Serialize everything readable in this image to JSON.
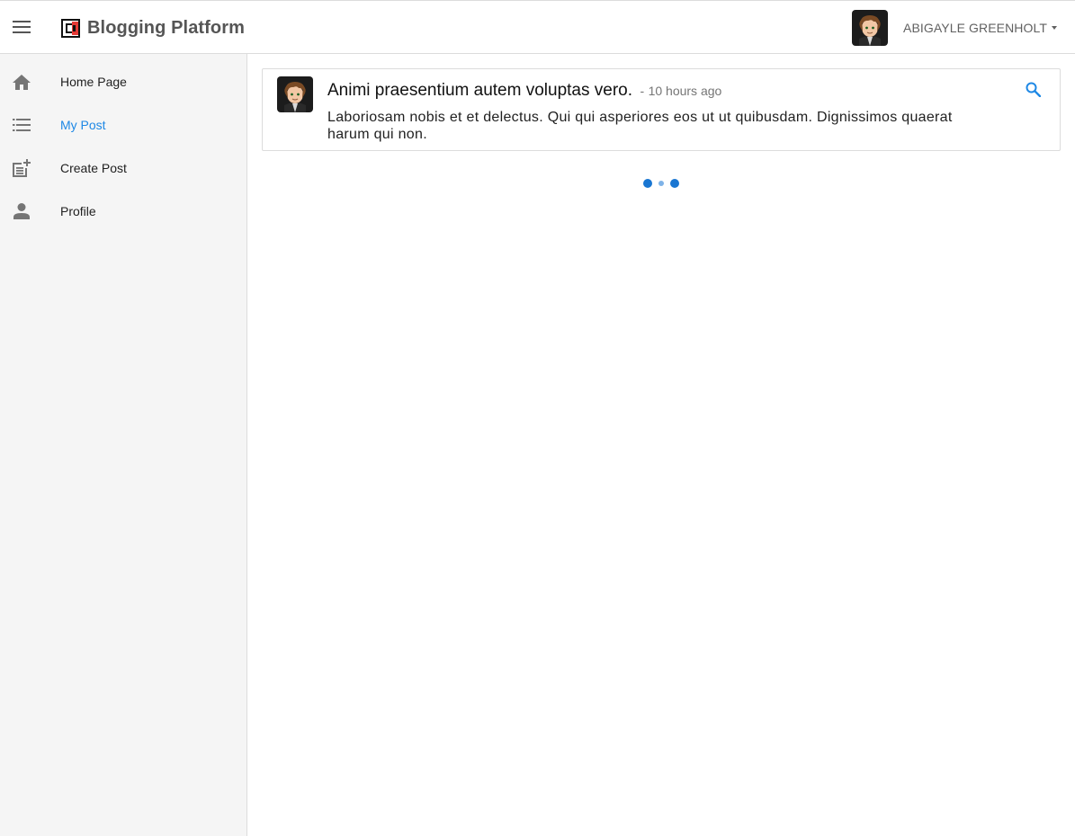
{
  "app": {
    "title": "Blogging Platform",
    "menu_icon": "hamburger-menu-icon",
    "logo_icon": "brand-logo-icon"
  },
  "user": {
    "name": "ABIGAYLE GREENHOLT",
    "avatar_icon": "cartoon-avatar",
    "dropdown_icon": "caret-down-icon"
  },
  "sidebar": {
    "items": [
      {
        "label": "Home Page",
        "icon": "home-icon",
        "active": false
      },
      {
        "label": "My Post",
        "icon": "list-icon",
        "active": true
      },
      {
        "label": "Create Post",
        "icon": "post-add-icon",
        "active": false
      },
      {
        "label": "Profile",
        "icon": "person-icon",
        "active": false
      }
    ]
  },
  "posts": [
    {
      "title": "Animi praesentium autem voluptas vero.",
      "separator": "-",
      "time": "10 hours ago",
      "body": "Laboriosam nobis et et delectus. Qui qui asperiores eos ut ut quibusdam. Dignissimos quaerat harum qui non."
    }
  ],
  "colors": {
    "accent": "#1e88e5",
    "sidebar_bg": "#f5f5f5",
    "loader": "#1976d2"
  }
}
